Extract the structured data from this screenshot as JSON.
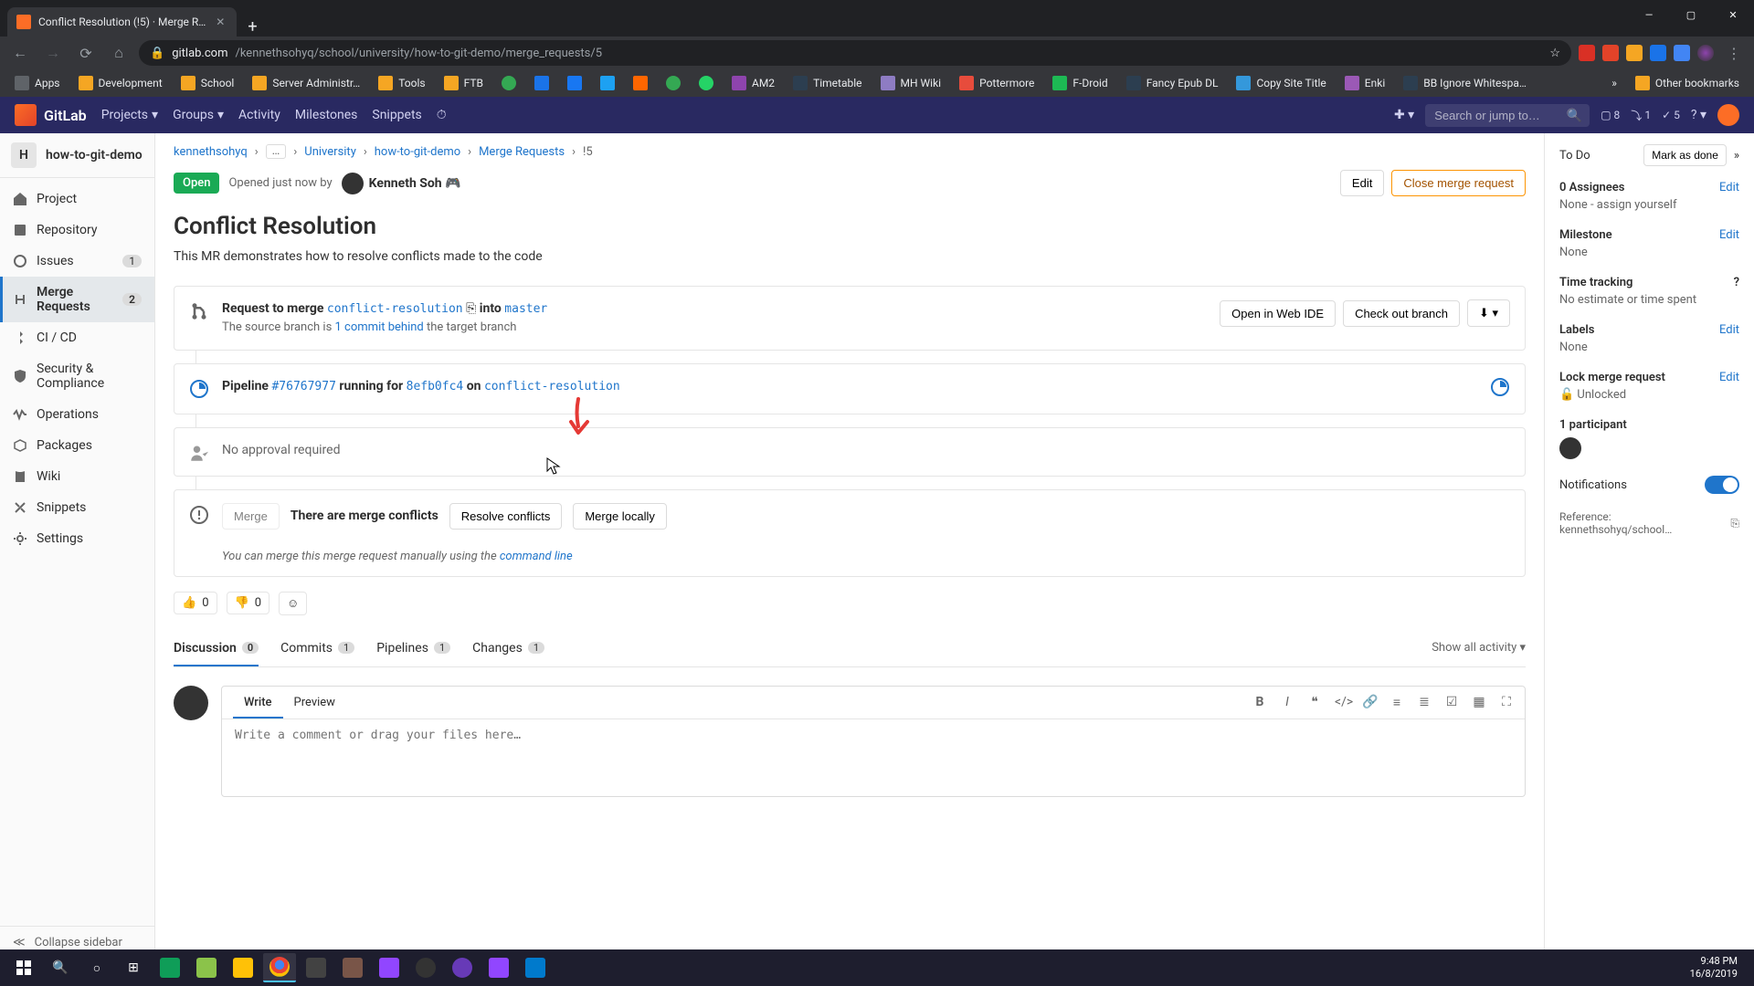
{
  "browser": {
    "tab_title": "Conflict Resolution (!5) · Merge R…",
    "url_host": "gitlab.com",
    "url_path": "/kennethsohyq/school/university/how-to-git-demo/merge_requests/5",
    "bookmarks": [
      "Apps",
      "Development",
      "School",
      "Server Administr…",
      "Tools",
      "FTB",
      "AM2",
      "Timetable",
      "MH Wiki",
      "Pottermore",
      "F-Droid",
      "Fancy Epub DL",
      "Copy Site Title",
      "Enki",
      "BB Ignore Whitespa…"
    ],
    "other_bookmarks": "Other bookmarks"
  },
  "header": {
    "brand": "GitLab",
    "nav": [
      "Projects",
      "Groups",
      "Activity",
      "Milestones",
      "Snippets"
    ],
    "search_placeholder": "Search or jump to…",
    "counts": {
      "issues": "8",
      "mrs": "1",
      "todos": "5"
    }
  },
  "sidebar": {
    "project_letter": "H",
    "project_name": "how-to-git-demo",
    "items": [
      {
        "label": "Project",
        "badge": ""
      },
      {
        "label": "Repository",
        "badge": ""
      },
      {
        "label": "Issues",
        "badge": "1"
      },
      {
        "label": "Merge Requests",
        "badge": "2"
      },
      {
        "label": "CI / CD",
        "badge": ""
      },
      {
        "label": "Security & Compliance",
        "badge": ""
      },
      {
        "label": "Operations",
        "badge": ""
      },
      {
        "label": "Packages",
        "badge": ""
      },
      {
        "label": "Wiki",
        "badge": ""
      },
      {
        "label": "Snippets",
        "badge": ""
      },
      {
        "label": "Settings",
        "badge": ""
      }
    ],
    "collapse": "Collapse sidebar"
  },
  "breadcrumb": {
    "items": [
      "kennethsohyq",
      "…",
      "University",
      "how-to-git-demo",
      "Merge Requests",
      "!5"
    ]
  },
  "mr": {
    "status": "Open",
    "opened": "Opened just now by",
    "author": "Kenneth Soh 🎮",
    "edit": "Edit",
    "close": "Close merge request",
    "title": "Conflict Resolution",
    "description": "This MR demonstrates how to resolve conflicts made to the code"
  },
  "widget": {
    "request": "Request to merge",
    "src_branch": "conflict-resolution",
    "into": "into",
    "tgt_branch": "master",
    "behind_pre": "The source branch is ",
    "behind_link": "1 commit behind",
    "behind_post": " the target branch",
    "open_ide": "Open in Web IDE",
    "checkout": "Check out branch",
    "pipeline": "Pipeline",
    "pipeline_id": "#76767977",
    "running_for": "running for",
    "commit": "8efb0fc4",
    "on": "on",
    "approval": "No approval required",
    "merge_btn": "Merge",
    "conflicts_text": "There are merge conflicts",
    "resolve_btn": "Resolve conflicts",
    "locally_btn": "Merge locally",
    "manual_pre": "You can merge this merge request manually using the ",
    "manual_link": "command line"
  },
  "reactions": {
    "up": "0",
    "down": "0"
  },
  "tabs": {
    "items": [
      {
        "label": "Discussion",
        "badge": "0"
      },
      {
        "label": "Commits",
        "badge": "1"
      },
      {
        "label": "Pipelines",
        "badge": "1"
      },
      {
        "label": "Changes",
        "badge": "1"
      }
    ],
    "filter": "Show all activity"
  },
  "comment": {
    "write": "Write",
    "preview": "Preview",
    "placeholder": "Write a comment or drag your files here…"
  },
  "right": {
    "todo": "To Do",
    "mark_done": "Mark as done",
    "assignees_title": "0 Assignees",
    "assignees_value": "None - assign yourself",
    "milestone_title": "Milestone",
    "milestone_value": "None",
    "time_title": "Time tracking",
    "time_value": "No estimate or time spent",
    "labels_title": "Labels",
    "labels_value": "None",
    "lock_title": "Lock merge request",
    "lock_value": "Unlocked",
    "participants": "1 participant",
    "notifications": "Notifications",
    "reference": "Reference: kennethsohyq/school…",
    "edit": "Edit"
  },
  "taskbar": {
    "time": "9:48 PM",
    "date": "16/8/2019"
  }
}
